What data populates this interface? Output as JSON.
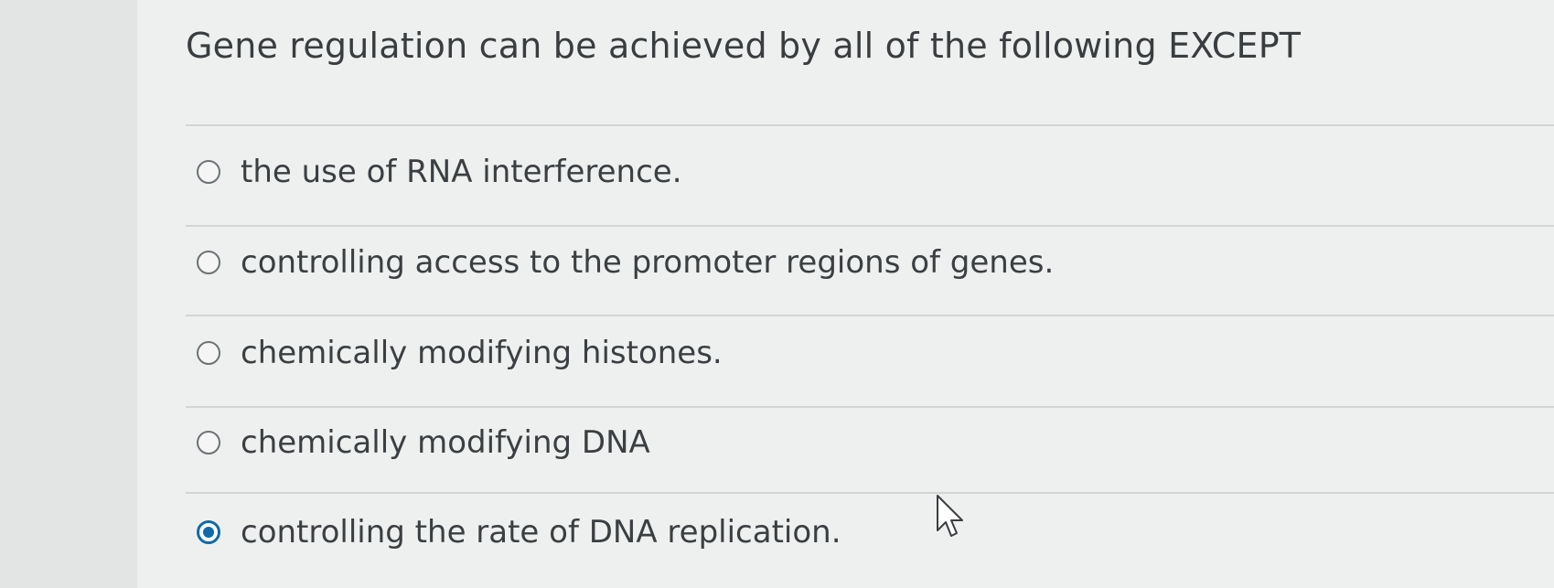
{
  "question": {
    "text": "Gene regulation can be achieved by all of the following EXCEPT"
  },
  "options": [
    {
      "label": "the use of RNA interference.",
      "selected": false
    },
    {
      "label": "controlling access to the promoter regions of genes.",
      "selected": false
    },
    {
      "label": "chemically modifying histones.",
      "selected": false
    },
    {
      "label": "chemically modifying DNA",
      "selected": false
    },
    {
      "label": "controlling the rate of DNA replication.",
      "selected": true
    }
  ],
  "colors": {
    "background": "#eef0ef",
    "text": "#3b3f42",
    "accent": "#0e6ba8",
    "divider": "#d2d5d4"
  },
  "icons": {
    "radio_unselected": "radio-unselected-icon",
    "radio_selected": "radio-selected-icon",
    "cursor": "mouse-pointer-icon"
  }
}
